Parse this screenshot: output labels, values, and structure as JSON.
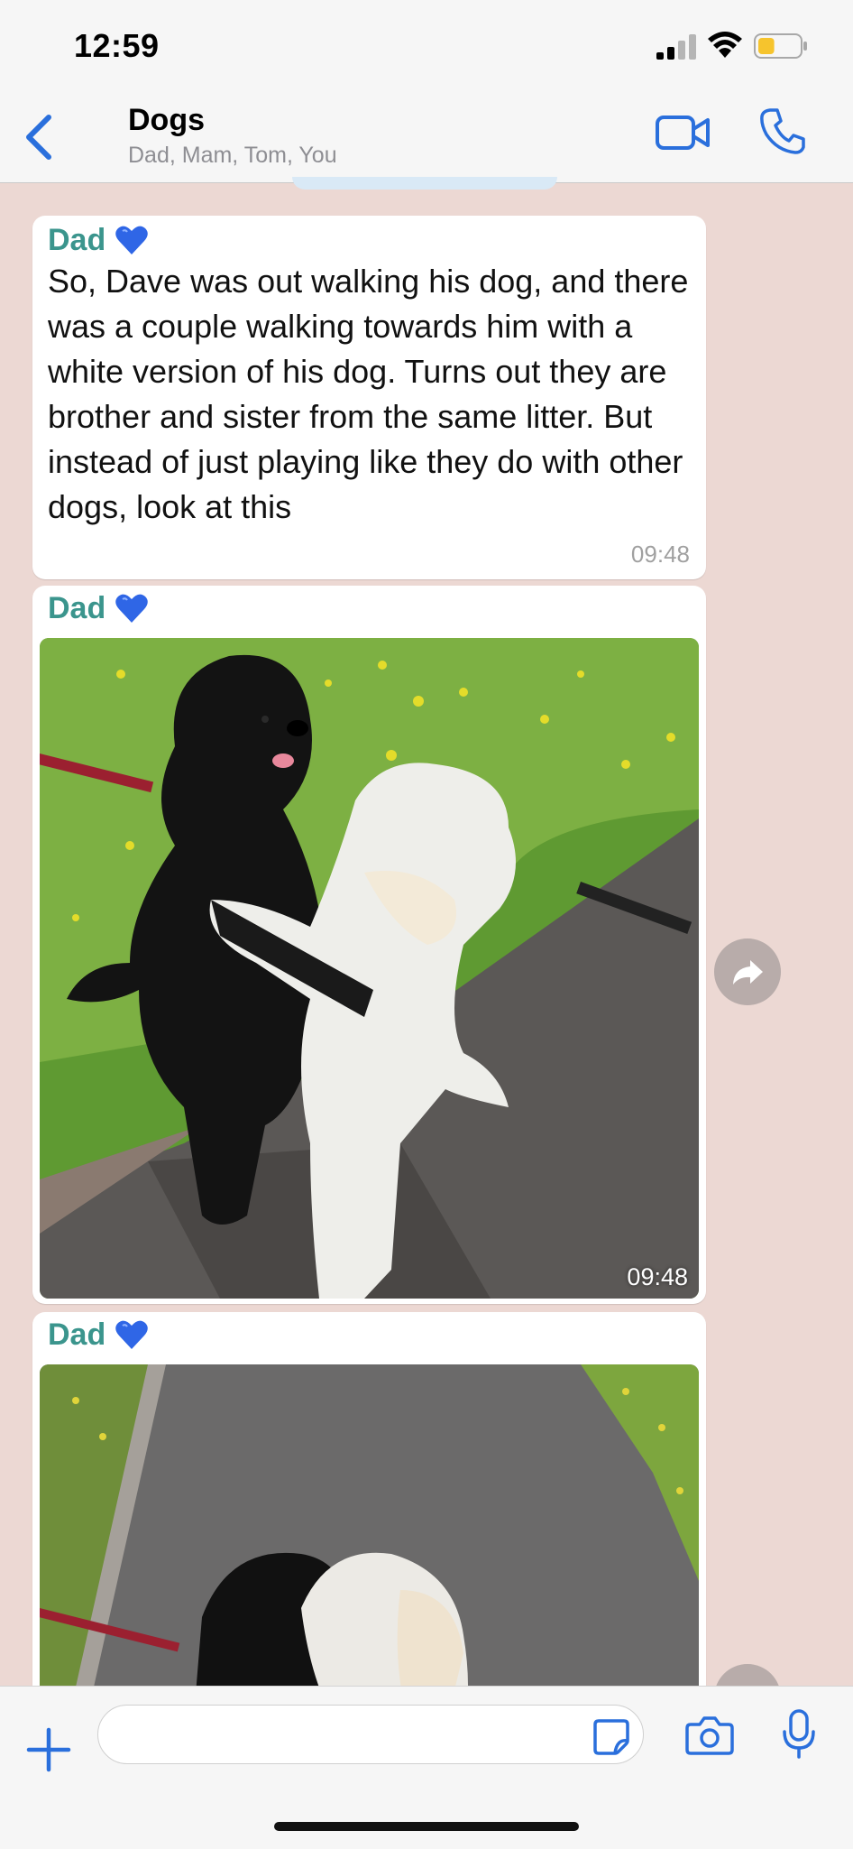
{
  "status_bar": {
    "time": "12:59",
    "battery_level": 0.4
  },
  "header": {
    "title": "Dogs",
    "members": "Dad, Mam, Tom, You",
    "icons": [
      "chevron-left-icon",
      "video-camera-icon",
      "phone-icon"
    ]
  },
  "messages": [
    {
      "sender": "Dad",
      "type": "text",
      "text": "So, Dave was out walking his dog, and there was a couple walking towards him with a white version of his dog. Turns out they are brother and sister from the same litter. But instead of just playing like they do with other dogs, look at this",
      "time": "09:48"
    },
    {
      "sender": "Dad",
      "type": "image",
      "time": "09:48"
    },
    {
      "sender": "Dad",
      "type": "image",
      "time": ""
    }
  ],
  "composer": {
    "placeholder": "",
    "value": ""
  },
  "colors": {
    "accent": "#2a6fdc",
    "sender_name": "#3b958d",
    "chat_background": "#ecd8d3",
    "bar_background": "#f6f6f6"
  }
}
